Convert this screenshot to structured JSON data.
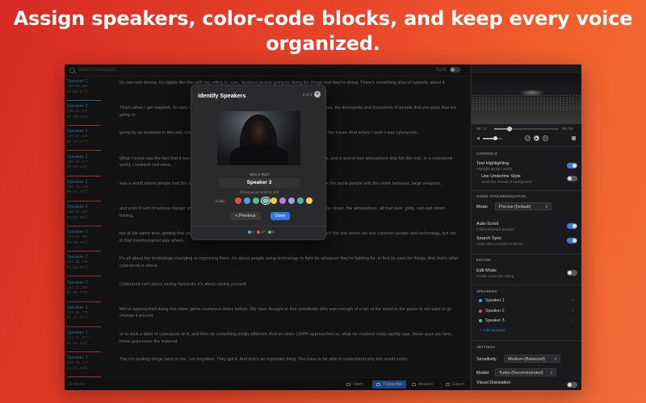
{
  "headline": "Assign speakers, color-code blocks, and keep every voice organized.",
  "search": {
    "placeholder": "Search transcript..."
  },
  "sync_label": "Sync",
  "segments": [
    {
      "speaker": "Speaker 1",
      "start": "[00:00.000 -",
      "end": "00:04.677]",
      "color": "#4aa3df",
      "text": "It's rain-wet streets, it's nights like this with fog rolling in, cars, faceless people going by doing the things that they're doing. There's something kind of hypnotic about it."
    },
    {
      "speaker": "Speaker 2",
      "start": "[00:13.577 -",
      "end": "00:19.453]",
      "color": "#e05050",
      "text": "That's when I get inspired. To carry what these streets are like, what the city is like, the mysteries, the stories, the thousands and thousands of people that you pass that are going to"
    },
    {
      "speaker": "Speaker 3",
      "start": "[00:19.453 -",
      "end": "00:26.277]",
      "color": "#e05050",
      "text": "going by as shadows in this wet, cold, dangerous environment. I wanted to grab that. I wanted to take it to the future. And where I took it was cyberpunk."
    },
    {
      "speaker": "Speaker 2",
      "start": "[00:26.277 -",
      "end": "00:35.133]",
      "color": "#e05050",
      "text": "What I loved was the fact that it was a combination of dystopian elements, high technology in some places, and a sort of noir atmosphere that felt film noir. In a cyberpunk world, I realized real soon,"
    },
    {
      "speaker": "Speaker 2",
      "start": "[00:35.133 -",
      "end": "00:44.477]",
      "color": "#e05050",
      "text": "was a world where people had the technology, but it didn't fundamentally change who they were. You have the same people with the same behavior, large weapons,"
    },
    {
      "speaker": "Speaker 2",
      "start": "[00:44.477 -",
      "end": "01:01.000]",
      "color": "#e05050",
      "text": "and a lot of sort of serious danger all about. The important part in cyberpunk is that it's about the people, the street, the atmosphere, all that dark, gritty, rain-wet street feeling,"
    },
    {
      "speaker": "Speaker 2",
      "start": "[01:01.000 -",
      "end": "01:16.848]",
      "color": "#e05050",
      "text": "but at the same time, getting that rock and roll lost and desperate feeling of people living on the edge. That's the line where we see common people and technology, but not in that transhumanist way where,"
    },
    {
      "speaker": "Speaker 2",
      "start": "[01:16.848 -",
      "end": "01:33.557]",
      "color": "#e05050",
      "text": "It's all about the technology changing or improving them. It's about people using technology to fight for whatever they're fighting for, to find its uses for things. And that's what cyberpunk is about."
    },
    {
      "speaker": "Speaker 2",
      "start": "[01:33.557 -",
      "end": "01:38.779]",
      "color": "#e05050",
      "text": "Cyberpunk isn't about saving humanity, it's about saving yourself."
    },
    {
      "speaker": "Speaker 3",
      "start": "[01:38.779 -",
      "end": "01:41.077]",
      "color": "#e05050",
      "text": "We've approached doing this video game numerous times before. We have thought to find somebody who was enough of a fan of the world in the game to not want to go change it around"
    },
    {
      "speaker": "Speaker 2",
      "start": "[01:41.077 -",
      "end": "01:56.133]",
      "color": "#e05050",
      "text": "or to stick a label of cyberpunk on it, and then do something totally different. And so when CDPR approached us, what we realized really rapidly was, these guys are fans, these guys know the material."
    },
    {
      "speaker": "Speaker 2",
      "start": "[01:56.133 -",
      "end": "02:07.540]",
      "color": "#e05050",
      "text": "They're quoting things back to me, I've forgotten. They got it. And that's an important thing. You have to be able to understand why this world exists."
    }
  ],
  "bottom": {
    "count": "12 blocks",
    "open": "Open",
    "transcribe": "Transcribe",
    "analyze": "Analyze",
    "export": "Export"
  },
  "player": {
    "current": "00:27",
    "total": "08:53",
    "progress": 0.24,
    "volume": 0.65
  },
  "panel": {
    "controls_title": "CONTROLS",
    "text_highlighting": "Text Highlighting",
    "text_highlighting_sub": "Highlight spoken words",
    "underline_style": "Use Underline Style",
    "underline_style_sub": "Underline instead of background",
    "audio_sync_title": "AUDIO SYNCHRONIZATION",
    "mode_label": "Mode",
    "mode_value": "Precise (Default)",
    "auto_scroll": "Auto-Scroll",
    "auto_scroll_sub": "Follow playback position",
    "search_sync": "Search Sync",
    "search_sync_sub": "Jump video to search matches",
    "editor_title": "EDITOR",
    "edit_mode": "Edit Mode",
    "edit_mode_sub": "Enable transcript editing",
    "speakers_title": "SPEAKERS",
    "speakers": [
      {
        "name": "Speaker 1",
        "color": "#4aa3df"
      },
      {
        "name": "Speaker 2",
        "color": "#e05050"
      },
      {
        "name": "Speaker 3",
        "color": "#4fc08d"
      }
    ],
    "add_speaker": "+ Add Speaker",
    "settings_title": "SETTINGS",
    "sensitivity_label": "Sensitivity",
    "sensitivity_value": "Medium (Balanced)",
    "model_label": "Model",
    "model_value": "Turbo (Recommended)",
    "visual_diarization": "Visual Diarization"
  },
  "modal": {
    "title": "Identify Speakers",
    "page": "3 of 3",
    "question": "Who is this?",
    "speaker_name": "Speaker 3",
    "first_appears": "First appears at 00:11.178",
    "color_label": "Color:",
    "swatches": [
      "#e05050",
      "#4aa3df",
      "#4fc08d",
      "#6fd3c7",
      "#f2c94c",
      "#c07ae0",
      "#a0a0f0",
      "#40c0a0",
      "#f0d060"
    ],
    "selected_swatch": 3,
    "previous": "< Previous",
    "done": "Done",
    "stats": [
      {
        "color": "#4aa3df",
        "count": "1"
      },
      {
        "color": "#e05050",
        "count": "17"
      },
      {
        "color": "#4fc08d",
        "count": "4"
      }
    ]
  }
}
